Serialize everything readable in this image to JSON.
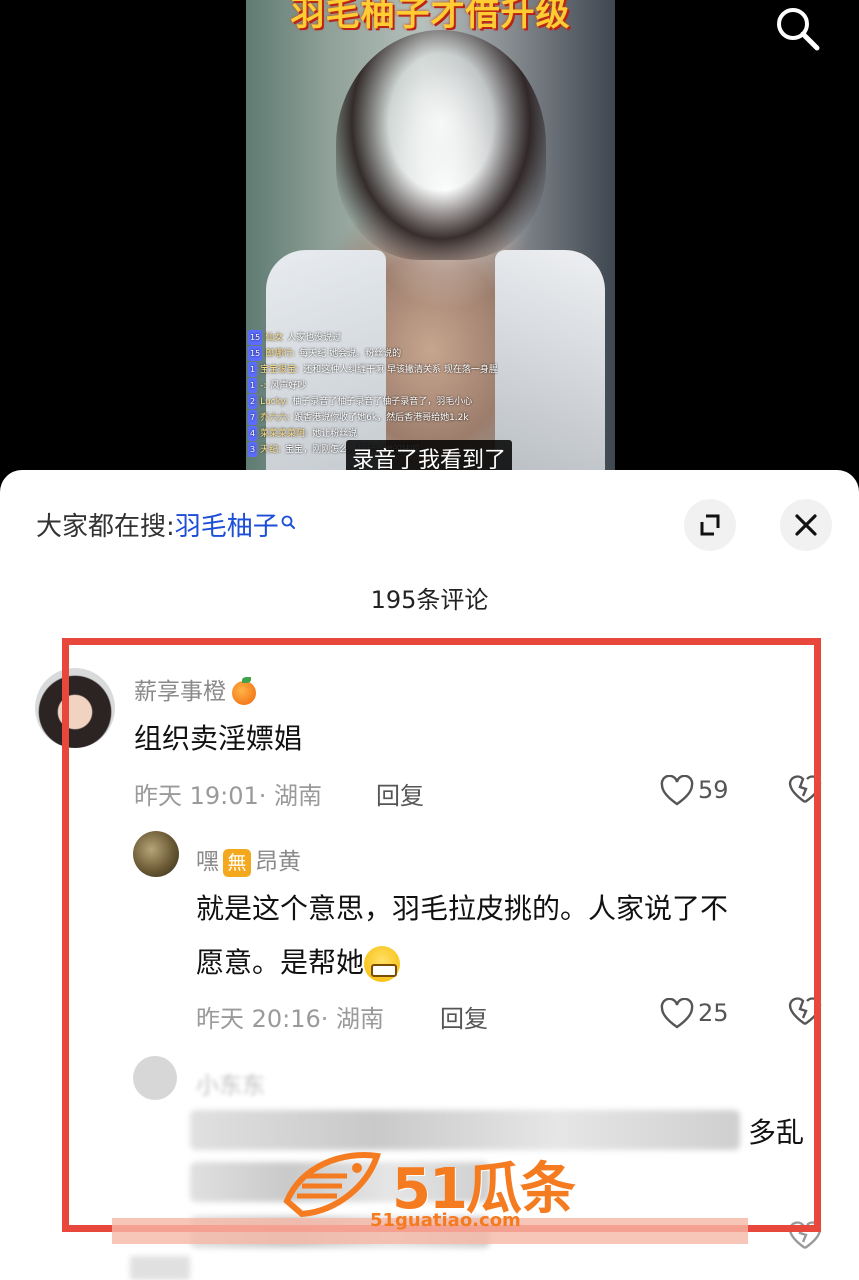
{
  "video": {
    "topic_overlay": "羽毛柚子才借升级",
    "subtitle": "录音了我看到了",
    "live_chat": [
      {
        "level": "15",
        "user": "仙女",
        "text": "人家也没说过"
      },
      {
        "level": "15",
        "user": "郎哪行:",
        "text": "每天纪 她会说。粉丝说的"
      },
      {
        "level": "1",
        "user": "宝宝很宝:",
        "text": "还和这种人纠缠干嘛 早该撇清关系 现在落一身腥"
      },
      {
        "level": "1",
        "user": "-:",
        "text": "风声好吵"
      },
      {
        "level": "2",
        "user": "Lucky:",
        "text": "柚子录音了柚子录音了柚子录音了，羽毛小心"
      },
      {
        "level": "7",
        "user": "乔六六:",
        "text": "跟香港说你收了她6k，然后香港哥给她1.2k"
      },
      {
        "level": "4",
        "user": "菜菜菜菜阿:",
        "text": "她让粉丝说"
      },
      {
        "level": "3",
        "user": "天纪:",
        "text": "宝宝，刚刚怎么...想起收她的钱呢。"
      }
    ],
    "search_icon": "search-icon"
  },
  "sheet": {
    "everyone_prefix": "大家都在搜:",
    "keyword": "羽毛柚子",
    "keyword_icon": "search-small-icon",
    "expand_icon": "expand-icon",
    "close_icon": "close-icon",
    "comment_count": "195条评论"
  },
  "comments": [
    {
      "username": "薪享事橙",
      "username_emoji": "orange-emoji",
      "text": "组织卖淫嫖娼",
      "meta": "昨天 19:01· 湖南",
      "reply_label": "回复",
      "likes": "59"
    },
    {
      "username_a": "嘿",
      "badge": "無",
      "username_b": "昂黄",
      "text_line1": "就是这个意思，羽毛拉皮挑的。人家说了不",
      "text_line2": "愿意。是帮她",
      "text_emoji": "grinning-sweat-emoji",
      "meta": "昨天 20:16· 湖南",
      "reply_label": "回复",
      "likes": "25"
    },
    {
      "username": "小东东",
      "text_visible_end": "多乱",
      "blurred": true
    }
  ],
  "watermark": {
    "brand": "51瓜条",
    "url": "51guatiao.com"
  },
  "colors": {
    "highlight_border": "#e8473c",
    "keyword_blue": "#1d4ed8",
    "watermark_orange": "#f47b20",
    "badge_orange": "#f4a81d"
  }
}
